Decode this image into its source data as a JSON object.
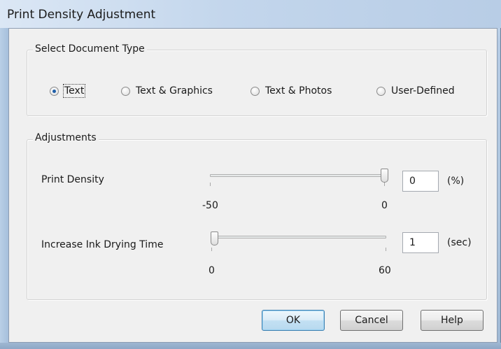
{
  "window": {
    "title": "Print Density Adjustment"
  },
  "document_type": {
    "legend": "Select Document Type",
    "options": [
      {
        "label": "Text",
        "selected": true
      },
      {
        "label": "Text & Graphics",
        "selected": false
      },
      {
        "label": "Text & Photos",
        "selected": false
      },
      {
        "label": "User-Defined",
        "selected": false
      }
    ]
  },
  "adjustments": {
    "legend": "Adjustments",
    "print_density": {
      "label": "Print Density",
      "min_label": "-50",
      "max_label": "0",
      "min": -50,
      "max": 0,
      "value": "0",
      "unit": "(%)"
    },
    "drying_time": {
      "label": "Increase Ink Drying Time",
      "min_label": "0",
      "max_label": "60",
      "min": 0,
      "max": 60,
      "value": "1",
      "unit": "(sec)"
    }
  },
  "buttons": {
    "ok": "OK",
    "cancel": "Cancel",
    "help": "Help"
  }
}
